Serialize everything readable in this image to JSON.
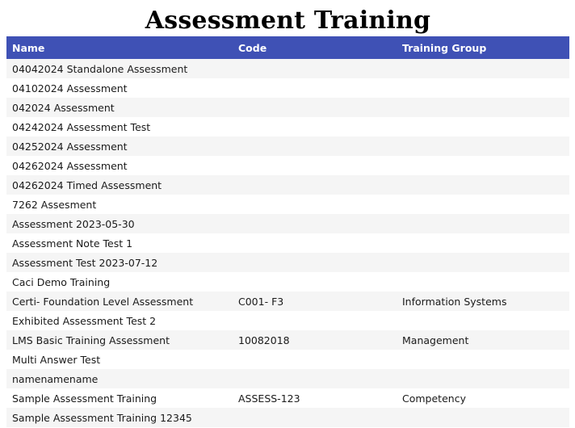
{
  "page": {
    "title": "Assessment Training"
  },
  "table": {
    "columns": [
      "Name",
      "Code",
      "Training Group"
    ],
    "rows": [
      {
        "name": "04042024 Standalone Assessment",
        "code": "",
        "group": ""
      },
      {
        "name": "04102024 Assessment",
        "code": "",
        "group": ""
      },
      {
        "name": "042024 Assessment",
        "code": "",
        "group": ""
      },
      {
        "name": "04242024 Assessment Test",
        "code": "",
        "group": ""
      },
      {
        "name": "04252024 Assessment",
        "code": "",
        "group": ""
      },
      {
        "name": "04262024 Assessment",
        "code": "",
        "group": ""
      },
      {
        "name": "04262024 Timed Assessment",
        "code": "",
        "group": ""
      },
      {
        "name": "7262 Assesment",
        "code": "",
        "group": ""
      },
      {
        "name": "Assessment 2023-05-30",
        "code": "",
        "group": ""
      },
      {
        "name": "Assessment Note Test 1",
        "code": "",
        "group": ""
      },
      {
        "name": "Assessment Test 2023-07-12",
        "code": "",
        "group": ""
      },
      {
        "name": "Caci Demo Training",
        "code": "",
        "group": ""
      },
      {
        "name": "Certi- Foundation Level Assessment",
        "code": "C001- F3",
        "group": "Information Systems"
      },
      {
        "name": "Exhibited Assessment Test 2",
        "code": "",
        "group": ""
      },
      {
        "name": "LMS Basic Training Assessment",
        "code": "10082018",
        "group": "Management"
      },
      {
        "name": "Multi Answer Test",
        "code": "",
        "group": ""
      },
      {
        "name": "namenamename",
        "code": "",
        "group": ""
      },
      {
        "name": "Sample Assessment Training",
        "code": "ASSESS-123",
        "group": "Competency"
      },
      {
        "name": "Sample Assessment Training 12345",
        "code": "",
        "group": ""
      }
    ]
  },
  "colors": {
    "header_bg": "#3f51b5",
    "header_text": "#ffffff",
    "row_alt_bg": "#f5f5f5",
    "row_bg": "#ffffff"
  }
}
